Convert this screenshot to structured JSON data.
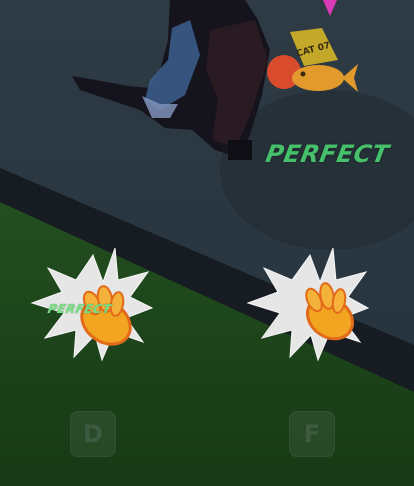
{
  "hud": {
    "judgement_main": "PERFECT",
    "judgement_small": "PERFECT"
  },
  "lanes": [
    {
      "key": "D",
      "icon": "hand-tap-icon"
    },
    {
      "key": "F",
      "icon": "hand-tap-icon"
    }
  ],
  "sign": {
    "text": "CAT 07"
  },
  "colors": {
    "wall": "#2b3843",
    "floor": "#1f4a1c",
    "perfect": "#46c06a",
    "burst": "#e4e4e4",
    "hand": "#f4b23a"
  }
}
